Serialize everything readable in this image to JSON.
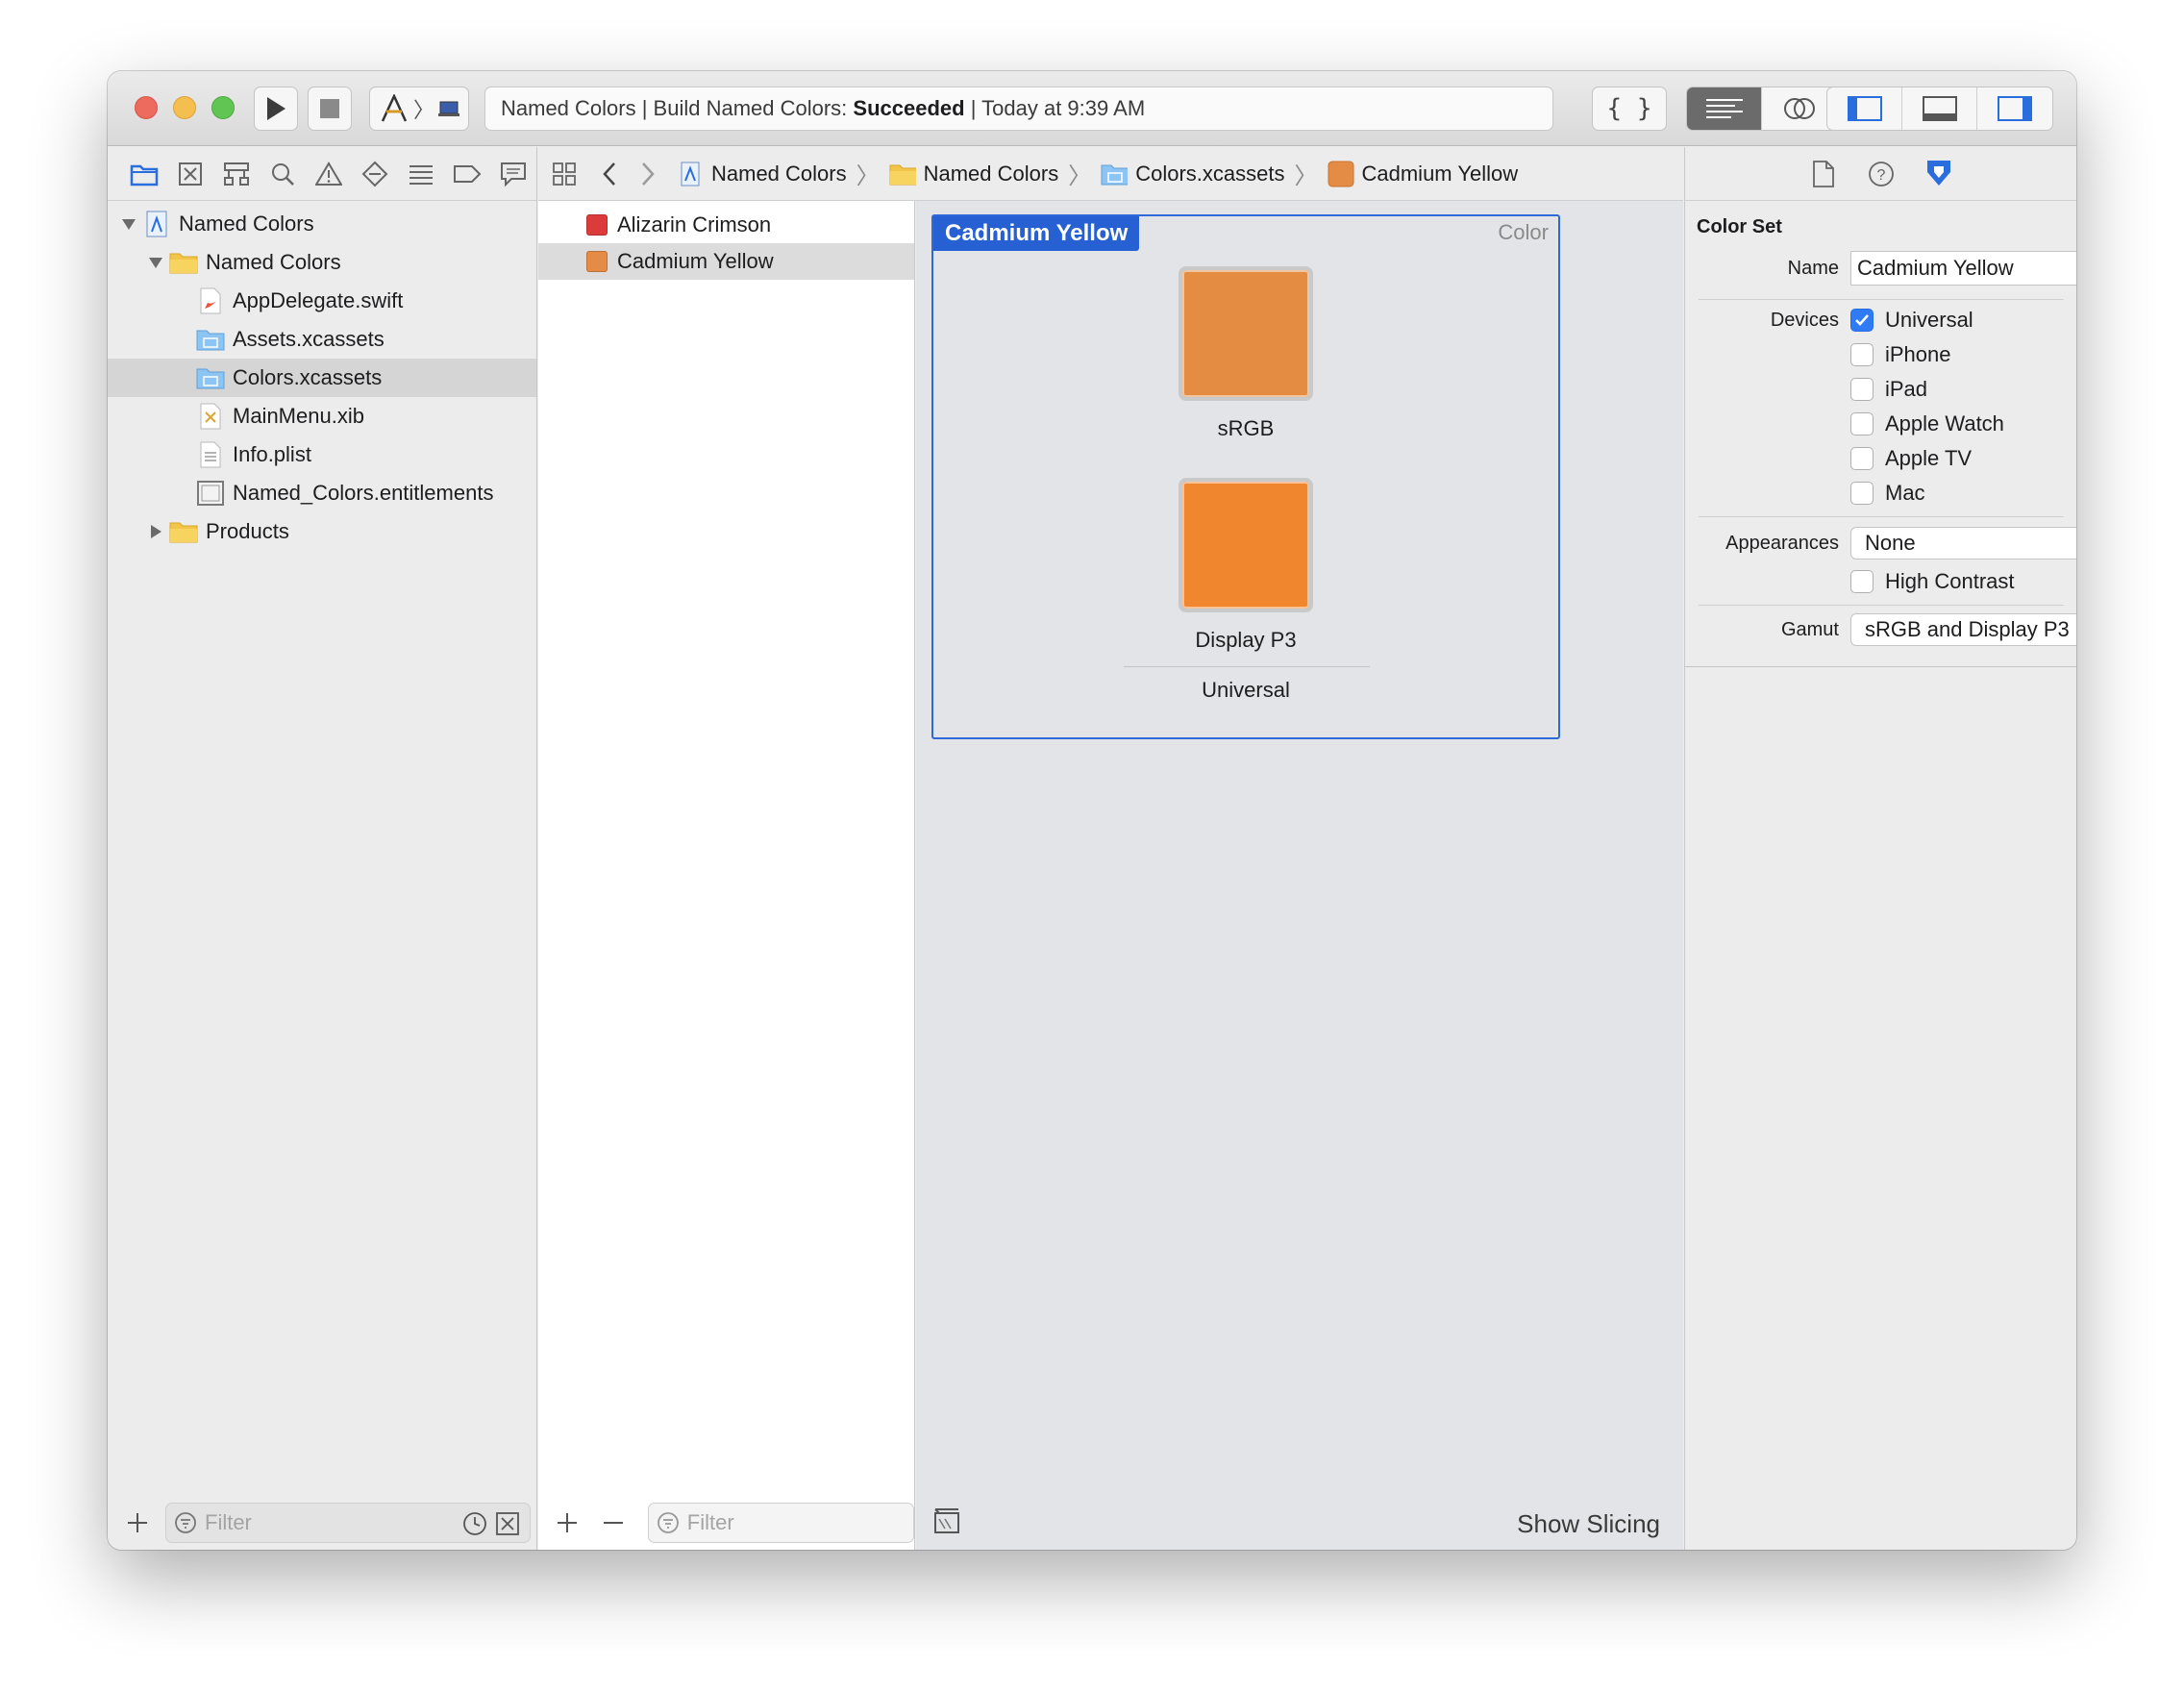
{
  "window": {
    "activity": {
      "prefix": "Named Colors | Build Named Colors:",
      "status": "Succeeded",
      "suffix": "| Today at 9:39 AM"
    }
  },
  "navigator": {
    "tree": [
      {
        "label": "Named Colors",
        "level": 0,
        "icon": "project-icon",
        "disclosure": "open"
      },
      {
        "label": "Named Colors",
        "level": 1,
        "icon": "folder-icon",
        "disclosure": "open"
      },
      {
        "label": "AppDelegate.swift",
        "level": 2,
        "icon": "swift-file-icon"
      },
      {
        "label": "Assets.xcassets",
        "level": 2,
        "icon": "asset-catalog-icon"
      },
      {
        "label": "Colors.xcassets",
        "level": 2,
        "icon": "asset-catalog-icon",
        "selected": true
      },
      {
        "label": "MainMenu.xib",
        "level": 2,
        "icon": "xib-file-icon"
      },
      {
        "label": "Info.plist",
        "level": 2,
        "icon": "plist-file-icon"
      },
      {
        "label": "Named_Colors.entitlements",
        "level": 2,
        "icon": "entitlements-file-icon"
      },
      {
        "label": "Products",
        "level": 1,
        "icon": "folder-icon",
        "disclosure": "closed"
      }
    ],
    "filter_placeholder": "Filter"
  },
  "jumpbar": {
    "crumbs": [
      "Named Colors",
      "Named Colors",
      "Colors.xcassets",
      "Cadmium Yellow"
    ]
  },
  "assets": {
    "items": [
      {
        "label": "Alizarin Crimson",
        "color": "#dc3b3b"
      },
      {
        "label": "Cadmium Yellow",
        "color": "#e48b45",
        "selected": true
      }
    ],
    "filter_placeholder": "Filter"
  },
  "colorset": {
    "title": "Cadmium Yellow",
    "kind": "Color",
    "swatches": [
      {
        "label": "sRGB",
        "color": "#e38c42"
      },
      {
        "label": "Display P3",
        "color": "#f0862e"
      }
    ],
    "group_label": "Universal",
    "show_slicing": "Show Slicing"
  },
  "inspector": {
    "section_title": "Color Set",
    "name_label": "Name",
    "name_value": "Cadmium Yellow",
    "devices_label": "Devices",
    "devices": [
      {
        "label": "Universal",
        "checked": true
      },
      {
        "label": "iPhone",
        "checked": false
      },
      {
        "label": "iPad",
        "checked": false
      },
      {
        "label": "Apple Watch",
        "checked": false
      },
      {
        "label": "Apple TV",
        "checked": false
      },
      {
        "label": "Mac",
        "checked": false
      }
    ],
    "appearances_label": "Appearances",
    "appearances_value": "None",
    "high_contrast_label": "High Contrast",
    "high_contrast_checked": false,
    "gamut_label": "Gamut",
    "gamut_value": "sRGB and Display P3"
  }
}
